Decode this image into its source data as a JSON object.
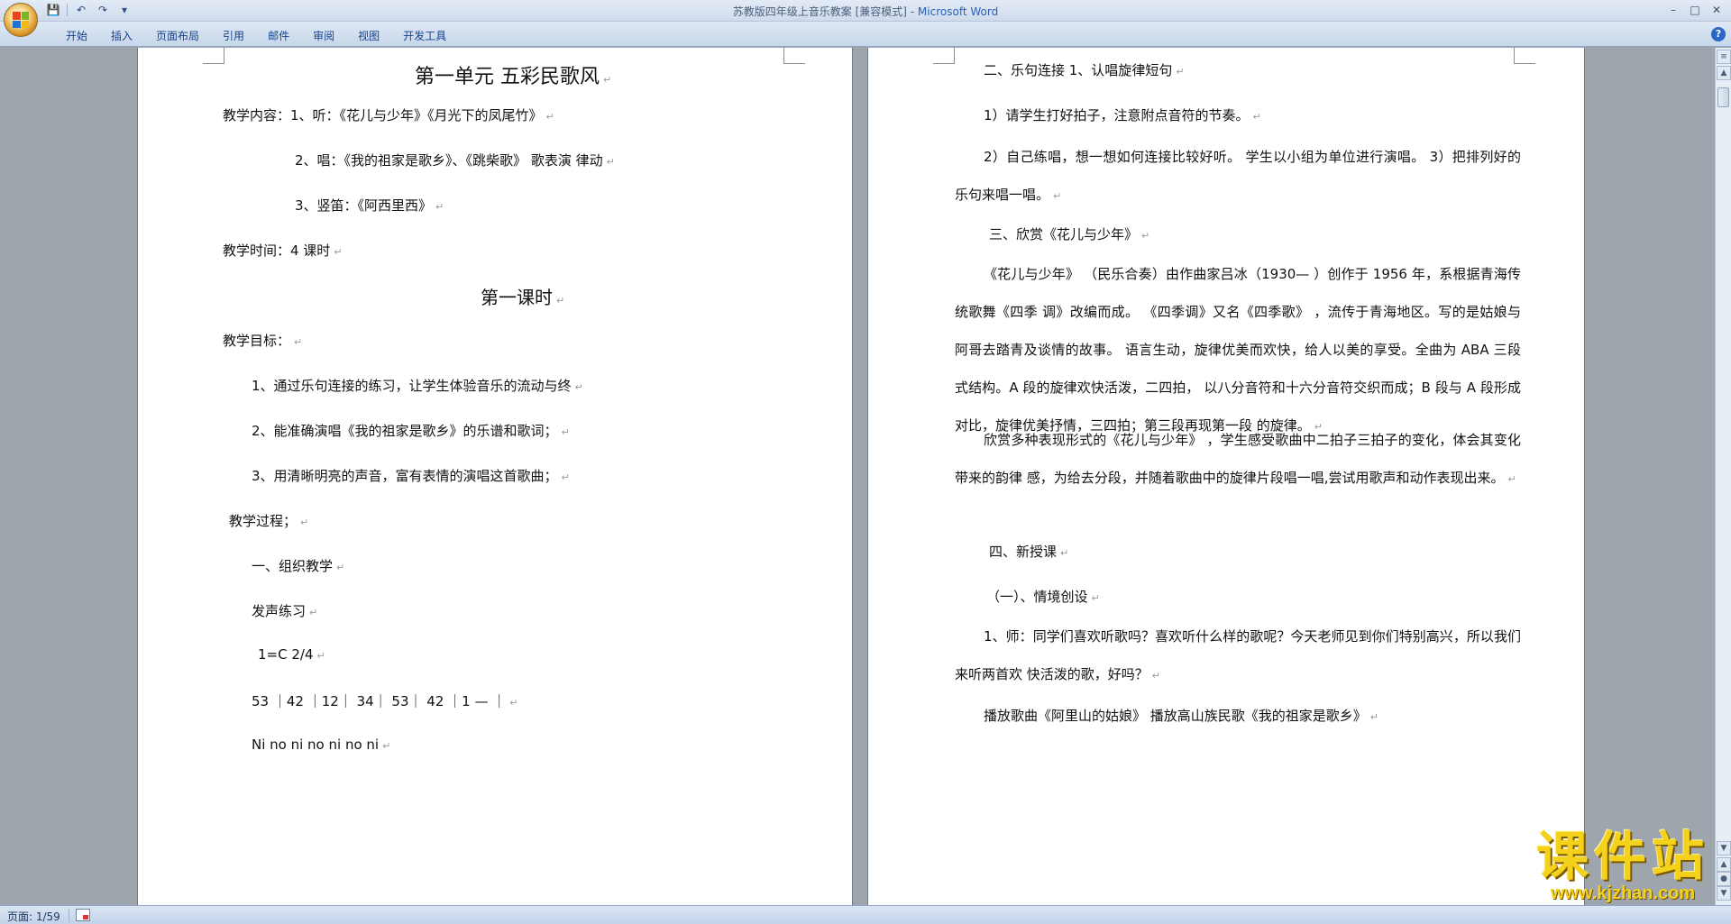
{
  "window": {
    "title_doc": "苏教版四年级上音乐教案 [兼容模式] - ",
    "title_app": "Microsoft Word"
  },
  "quick_access": {
    "save": "💾",
    "undo": "↶",
    "redo": "↷",
    "customize": "▾"
  },
  "win_controls": {
    "minimize": "–",
    "maximize": "□",
    "close": "✕"
  },
  "ribbon": {
    "tabs": [
      "开始",
      "插入",
      "页面布局",
      "引用",
      "邮件",
      "审阅",
      "视图",
      "开发工具"
    ],
    "help": "?"
  },
  "left_page": {
    "title": "第一单元  五彩民歌风",
    "content_label": "教学内容：1、听：《花儿与少年》《月光下的凤尾竹》",
    "content_2": "2、唱：《我的祖家是歌乡》、《跳柴歌》 歌表演  律动",
    "content_3": "3、竖笛：《阿西里西》",
    "time": "教学时间：4 课时",
    "lesson": "第一课时",
    "goal_label": "教学目标：",
    "goal_1": "1、通过乐句连接的练习，让学生体验音乐的流动与终",
    "goal_2": "2、能准确演唱《我的祖家是歌乡》的乐谱和歌词；",
    "goal_3": "3、用清晰明亮的声音，富有表情的演唱这首歌曲；",
    "process": "教学过程；",
    "step_1": "一、组织教学",
    "vocal": "发声练习",
    "key": "1=C 2/4",
    "notation": "53  ｜42 ｜12｜  34｜ 53｜  42  ｜1 — ｜",
    "syllables": "Ni    no       ni      no      ni       no      ni"
  },
  "right_page": {
    "s2": "二、乐句连接 1、认唱旋律短句",
    "p1": "1）请学生打好拍子，注意附点音符的节奏。",
    "p2": "2）自己练唱，想一想如何连接比较好听。 学生以小组为单位进行演唱。 3）把排列好的乐句来唱一唱。",
    "s3": "三、欣赏《花儿与少年》",
    "p3": "《花儿与少年》 （民乐合奏）由作曲家吕冰（1930—  ）创作于 1956 年，系根据青海传统歌舞《四季 调》改编而成。 《四季调》又名《四季歌》 ，流传于青海地区。写的是姑娘与阿哥去踏青及谈情的故事。 语言生动，旋律优美而欢快，给人以美的享受。全曲为 ABA 三段式结构。A 段的旋律欢快活泼，二四拍， 以八分音符和十六分音符交织而成；B 段与 A 段形成对比，旋律优美抒情，三四拍；第三段再现第一段  的旋律。",
    "p4": "欣赏多种表现形式的《花儿与少年》 ，学生感受歌曲中二拍子三拍子的变化，体会其变化带来的韵律 感，为给去分段，并随着歌曲中的旋律片段唱一唱,尝试用歌声和动作表现出来。",
    "s4": "四、新授课",
    "sub1": "（一）、情境创设",
    "p5": "1、师：同学们喜欢听歌吗？喜欢听什么样的歌呢？今天老师见到你们特别高兴，所以我们来听两首欢  快活泼的歌，好吗？",
    "p6": "播放歌曲《阿里山的姑娘》  播放高山族民歌《我的祖家是歌乡》"
  },
  "paragraph_mark": "↵",
  "status": {
    "page": "页面: 1/59"
  },
  "watermark": {
    "title": "课件站",
    "url": "www.kjzhan.com"
  }
}
